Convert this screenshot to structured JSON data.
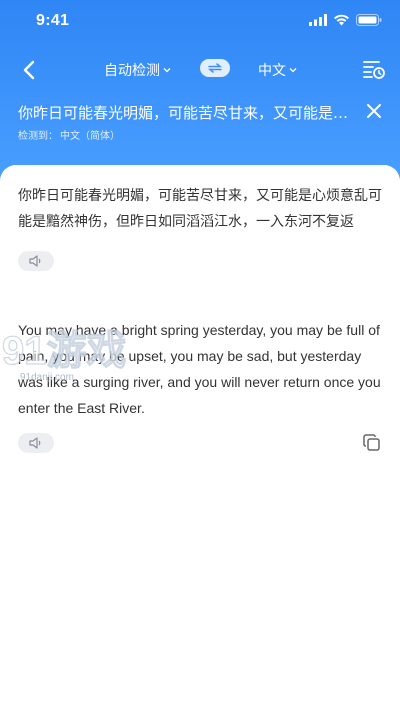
{
  "status_bar": {
    "time": "9:41"
  },
  "nav": {
    "source_lang": "自动检测",
    "target_lang": "中文",
    "swap_glyph": "⇌"
  },
  "query": {
    "source_text": "你昨日可能春光明媚，可能苦尽甘来，又可能是心烦意乱可能是黯然神伤，但昨日如同滔滔江水，一入东河不复返",
    "detected_prefix": "检测到：",
    "detected_lang": "中文（简体）"
  },
  "result": {
    "original_text": "你昨日可能春光明媚，可能苦尽甘来，又可能是心烦意乱可能是黯然神伤，但昨日如同滔滔江水，一入东河不复返",
    "translation_text": "You may have a bright spring yesterday, you may be full of pain, you may be upset, you may be sad, but yesterday was like a surging river, and you will never return once you enter the East River."
  },
  "watermark": {
    "text": "91游戏",
    "url": "91danji.com"
  },
  "colors": {
    "header_top": "#2f86f5",
    "header_bottom": "#4aa0ff",
    "pill_bg": "#eceef2",
    "text": "#333333"
  },
  "icons": [
    "signal-icon",
    "wifi-icon",
    "battery-icon",
    "back-icon",
    "chevron-down-icon",
    "swap-icon",
    "history-icon",
    "close-icon",
    "speaker-icon",
    "copy-icon"
  ]
}
